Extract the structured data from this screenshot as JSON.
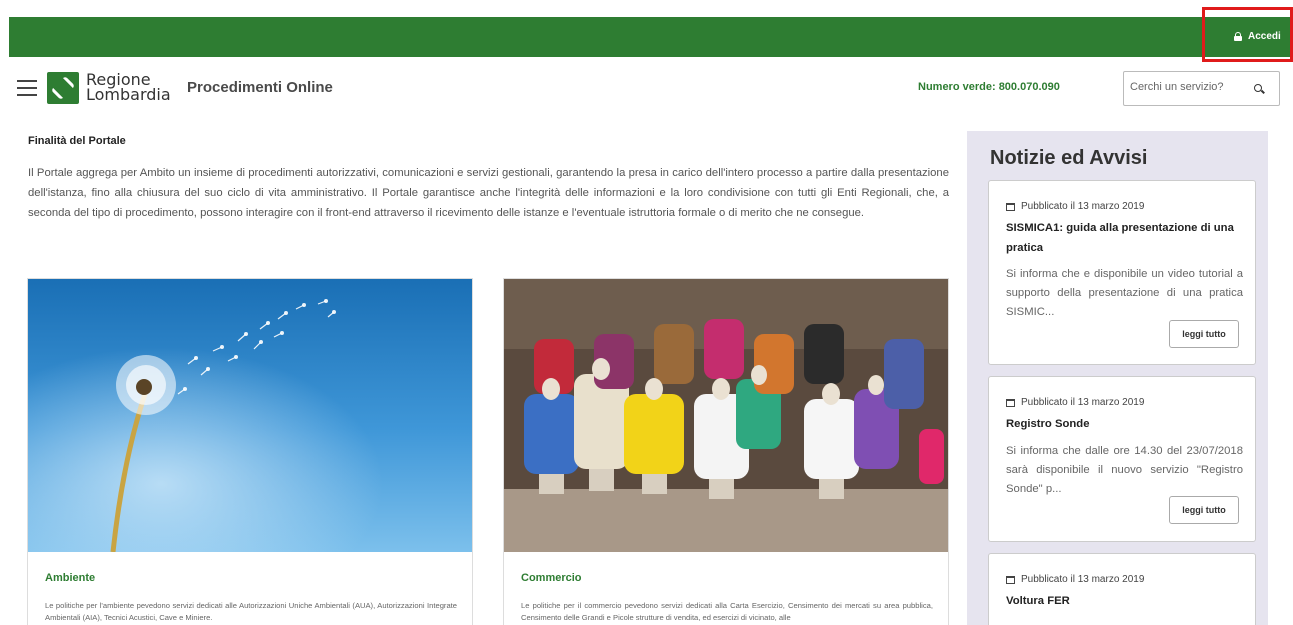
{
  "header": {
    "login_label": "Accedi",
    "logo_line1": "Regione",
    "logo_line2": "Lombardia",
    "site_title": "Procedimenti Online",
    "phone": "Numero verde: 800.070.090",
    "search_placeholder": "Cerchi un servizio?"
  },
  "intro": {
    "title": "Finalità del Portale",
    "text": "Il Portale aggrega per Ambito un insieme di procedimenti autorizzativi, comunicazioni e servizi gestionali, garantendo la presa in carico dell'intero processo a partire dalla presentazione dell'istanza, fino alla chiusura del suo ciclo di vita amministrativo. Il Portale garantisce anche l'integrità delle informazioni e la loro condivisione con tutti gli Enti Regionali, che, a seconda del tipo di procedimento, possono interagire con il front-end attraverso il ricevimento delle istanze e l'eventuale istruttoria formale o di merito che ne consegue."
  },
  "cards": [
    {
      "title": "Ambiente",
      "text": "Le politiche per l'ambiente pevedono servizi dedicati alle Autorizzazioni Uniche Ambientali (AUA), Autorizzazioni Integrate Ambientali (AIA), Tecnici Acustici, Cave e Miniere."
    },
    {
      "title": "Commercio",
      "text": "Le politiche per il commercio pevedono servizi dedicati alla Carta Esercizio, Censimento dei mercati su area pubblica, Censimento delle Grandi e Picole strutture di vendita, ed esercizi di vicinato, alle"
    }
  ],
  "news": {
    "heading": "Notizie ed Avvisi",
    "items": [
      {
        "date": "Pubblicato il 13 marzo 2019",
        "title": "SISMICA1: guida alla presentazione di una pratica",
        "text": "Si informa che e disponibile un video tutorial a supporto della presentazione di una pratica SISMIC...",
        "more": "leggi tutto"
      },
      {
        "date": "Pubblicato il 13 marzo 2019",
        "title": "Registro Sonde",
        "text": "Si informa che dalle ore 14.30 del 23/07/2018 sarà disponibile il nuovo servizio \"Registro Sonde\" p...",
        "more": "leggi tutto"
      },
      {
        "date": "Pubblicato il 13 marzo 2019",
        "title": "Voltura FER"
      }
    ]
  },
  "colors": {
    "brand_green": "#2e7d32",
    "sidebar_bg": "#e6e4ef",
    "highlight_red": "#e01b1b"
  }
}
